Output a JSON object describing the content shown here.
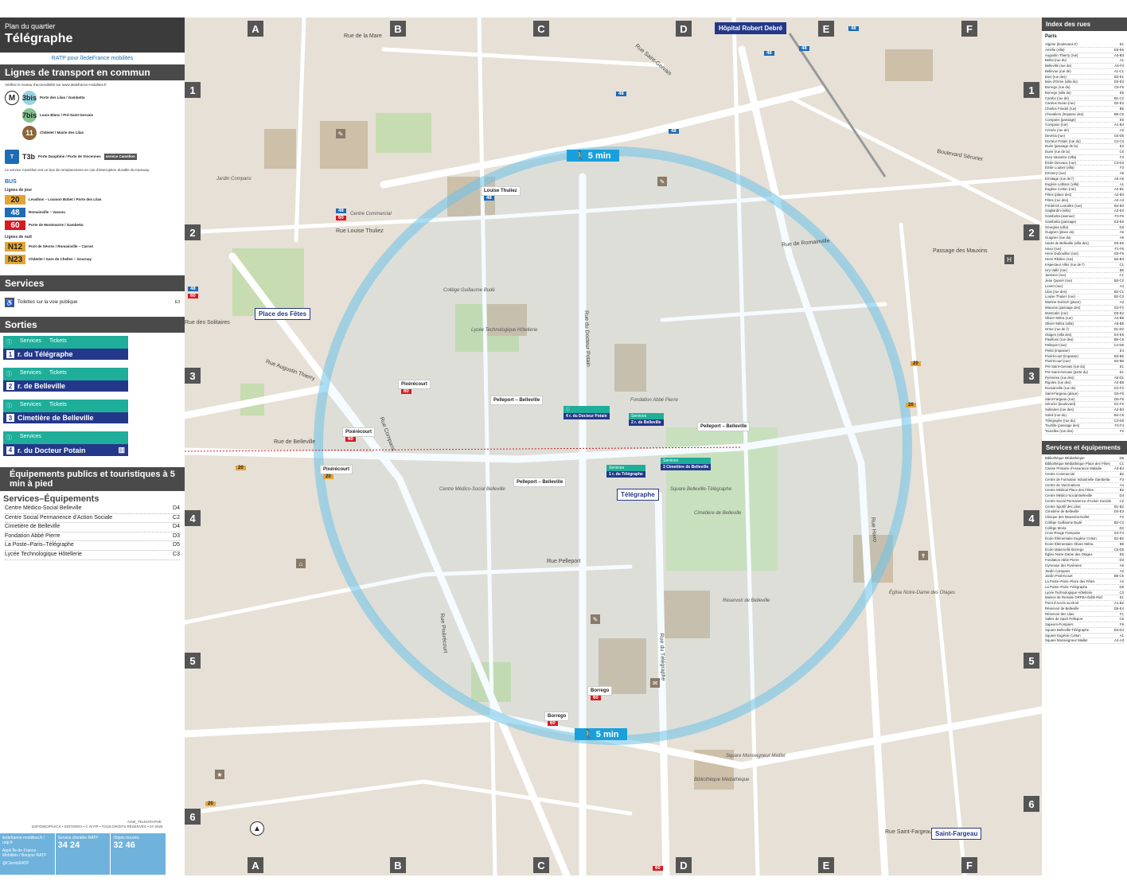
{
  "header": {
    "pre": "Plan du quartier",
    "title": "Télégraphe"
  },
  "logos": {
    "text": "RATP pour îledeFrance mobilités"
  },
  "transport": {
    "title": "Lignes de transport en commun",
    "note": "Vérifiez le niveau d'accessibilité sur www.iledefrance-mobilites.fr",
    "metro": [
      {
        "line": "3bis",
        "dest": "Porte des Lilas / Gambetta",
        "color": "#98d4e2"
      },
      {
        "line": "7bis",
        "dest": "Louis Blanc / Pré-Saint-Gervais",
        "color": "#84c28e"
      },
      {
        "line": "11",
        "dest": "Châtelet / Mairie des Lilas",
        "color": "#8e6538"
      }
    ],
    "tram": {
      "line": "T3b",
      "dest": "Porte Dauphine / Porte de Vincennes",
      "service": "service Camélion"
    },
    "tram_note": "Le service Camélion est un bus de remplacement en cas d'interruption durable du tramway.",
    "bus_label": "BUS",
    "day_label": "Lignes de jour",
    "day": [
      {
        "line": "20",
        "dest": "Levallois – Louison Bobet / Porte des Lilas",
        "color": "#e3a436"
      },
      {
        "line": "48",
        "dest": "Romainville – Vassou",
        "color": "#1f6bb4"
      },
      {
        "line": "60",
        "dest": "Porte de Montmartre / Gambetta",
        "color": "#d71920"
      }
    ],
    "night_label": "Lignes de nuit",
    "night": [
      {
        "line": "N12",
        "dest": "Pont de Sèvres / Romainville – Carnot",
        "color": "#e3a436"
      },
      {
        "line": "N23",
        "dest": "Châtelet / Gare de Chelles – Gournay",
        "color": "#e3a436"
      }
    ]
  },
  "services": {
    "title": "Services",
    "toilets": "Toilettes sur la voie publique",
    "toilets_ref": "E3"
  },
  "sorties": {
    "title": "Sorties",
    "exits": [
      {
        "num": "1",
        "services": "Services",
        "tickets": "Tickets",
        "name": "r. du Télégraphe"
      },
      {
        "num": "2",
        "services": "Services",
        "tickets": "Tickets",
        "name": "r. de Belleville"
      },
      {
        "num": "3",
        "services": "Services",
        "tickets": "Tickets",
        "name": "Cimetière de Belleville"
      },
      {
        "num": "4",
        "services": "Services",
        "tickets": "",
        "name": "r. du Docteur Potain"
      }
    ]
  },
  "equip": {
    "title": "Équipements publics et touristiques à 5 min à pied",
    "sub": "Services–Équipements",
    "items": [
      {
        "name": "Centre Médico-Social Belleville",
        "ref": "D4"
      },
      {
        "name": "Centre Social Permanence d'Action Sociale",
        "ref": "C2"
      },
      {
        "name": "Cimetière de Belleville",
        "ref": "D4"
      },
      {
        "name": "Fondation Abbé Pierre",
        "ref": "D3"
      },
      {
        "name": "La Poste–Paris–Télégraphe",
        "ref": "D5"
      },
      {
        "name": "Lycée Technologique Hôtellerie",
        "ref": "C3"
      }
    ]
  },
  "footer": {
    "web": "iledefrance-mobilites.fr / ratp.fr",
    "app": "Appli Île-de-France Mobilités / Bonjour RATP",
    "social": "@ClientsRATP",
    "svc_title": "Service clientèle RATP",
    "svc_phone": "34 24",
    "lost_title": "Objets trouvés",
    "lost_phone": "32 46",
    "credit": "DSF/DMO/PIVICS • EDITERRA • © RATP • TOUS DROITS RÉSERVÉS • 07-2025",
    "code": "AGM_TELEGRAPHE"
  },
  "map": {
    "cols": [
      "A",
      "B",
      "C",
      "D",
      "E",
      "F"
    ],
    "rows": [
      "1",
      "2",
      "3",
      "4",
      "5",
      "6"
    ],
    "walk_label": "5 min",
    "stations": [
      "Place des Fêtes",
      "Télégraphe",
      "Saint-Fargeau",
      "Hôpital Robert Debré"
    ],
    "stops": [
      "Louise Thuliez",
      "Pixérécourt",
      "Pixérécourt",
      "Pixérécourt",
      "Pelleport – Belleville",
      "Pelleport – Belleville",
      "Pelleport – Belleville",
      "Borrego",
      "Borrego"
    ],
    "streets": [
      "Rue de Belleville",
      "Rue Compans",
      "Rue Pixérécourt",
      "Rue du Télégraphe",
      "Rue Pelleport",
      "Rue Haxo",
      "Boulevard Sérurier",
      "Rue Saint-Fargeau",
      "Rue de la Mare",
      "Rue des Solitaires",
      "Rue du Docteur Potain",
      "Rue Louise Thuliez",
      "Rue de Romainville",
      "Rue Saint-Gervais",
      "Passage des Mauxins",
      "Rue Augustin Thierry"
    ],
    "places": [
      "Square Monseigneur Maillet",
      "Cimetière de Belleville",
      "Lycée Technologique Hôtellerie",
      "Centre Médico-Social Belleville",
      "Fondation Abbé Pierre",
      "Réservoir de Belleville",
      "Square Belleville-Télégraphe",
      "Bibliothèque Médiathèque",
      "Jardin Compans",
      "Centre Commercial",
      "Collège Guillaume Budé",
      "Église Notre-Dame des Otages"
    ]
  },
  "index": {
    "title": "Index des rues",
    "city": "Paris",
    "streets": [
      [
        "Algérie (boulevard d')",
        "E1"
      ],
      [
        "Amélie (villa)",
        "E5-E6"
      ],
      [
        "Augustin Thierry (rue)",
        "A3-B3"
      ],
      [
        "Bellot (rue du)",
        "A1"
      ],
      [
        "Belleville (rue de)",
        "A3-F3"
      ],
      [
        "Bellevue (rue de)",
        "A1-C1"
      ],
      [
        "Bois (rue des)",
        "B2-E1"
      ],
      [
        "Bois d'Orme (villa du)",
        "D3-E3"
      ],
      [
        "Borrego (rue du)",
        "C5-F5"
      ],
      [
        "Borrego (villa du)",
        "E5"
      ],
      [
        "Cambo (rue de)",
        "B1-C2"
      ],
      [
        "Carolus Duran (rue)",
        "D2-E2"
      ],
      [
        "Charles Friedel (rue)",
        "B5"
      ],
      [
        "Chevaliers (impasse des)",
        "B6-C6"
      ],
      [
        "Compans (passage)",
        "E5"
      ],
      [
        "Compans (rue)",
        "A1-B4"
      ],
      [
        "Crimée (rue de)",
        "A2"
      ],
      [
        "Devéria (rue)",
        "C6-D5"
      ],
      [
        "Docteur Potain (rue du)",
        "C2-C3"
      ],
      [
        "Duée (passage de la)",
        "E3"
      ],
      [
        "Duée (rue de la)",
        "C5"
      ],
      [
        "Dury-Vasselon (villa)",
        "F3"
      ],
      [
        "Émile Desvaux (rue)",
        "C3-D3"
      ],
      [
        "Émile Loubet (villa)",
        "F3"
      ],
      [
        "Emmery (rue)",
        "A6"
      ],
      [
        "Ermitage (rue de l')",
        "A5-A6"
      ],
      [
        "Eugène Leblanc (villa)",
        "A1"
      ],
      [
        "Eugène Cotton (rue)",
        "A2-B1"
      ],
      [
        "Fêtes (place des)",
        "A2-B3"
      ],
      [
        "Fêtes (rue des)",
        "A2-A3"
      ],
      [
        "Frédérick Lemaître (rue)",
        "B4-B3"
      ],
      [
        "Gagliardini (villa)",
        "A3-E3"
      ],
      [
        "Gambetta (avenue)",
        "F3-F6"
      ],
      [
        "Gambetta (passage)",
        "E3-E6"
      ],
      [
        "Georgina (villa)",
        "D3"
      ],
      [
        "Guignier (place du)",
        "A6"
      ],
      [
        "Guignier (rue du)",
        "A6"
      ],
      [
        "Hauts de Belleville (villa des)",
        "E5-E6"
      ],
      [
        "Haxo (rue)",
        "F1-F6"
      ],
      [
        "Henri Dubouillon (rue)",
        "E5-F5"
      ],
      [
        "Henri Ribière (rue)",
        "B2-B3"
      ],
      [
        "Inspecteur Allès (rue de l')",
        "C1"
      ],
      [
        "Ivry-Vallé (rue)",
        "B5"
      ],
      [
        "Janssen (rue)",
        "C1"
      ],
      [
        "Jean Quarré (rue)",
        "B3-C2"
      ],
      [
        "Levert (rue)",
        "A4"
      ],
      [
        "Lilas (rue des)",
        "B2-C1"
      ],
      [
        "Louise Thuliez (rue)",
        "B2-C2"
      ],
      [
        "Martine Durlach (place)",
        "A3"
      ],
      [
        "Mauxins (passage des)",
        "E2-F2"
      ],
      [
        "Montcalm (rue)",
        "D3-E2"
      ],
      [
        "Olivier Métra (rue)",
        "A4-B6"
      ],
      [
        "Olivier Métra (villa)",
        "A5-B5"
      ],
      [
        "Orme (rue de l')",
        "D1-D2"
      ],
      [
        "Otages (villa des)",
        "E4-E5"
      ],
      [
        "Pavillons (rue des)",
        "B6-C6"
      ],
      [
        "Pelleport (rue)",
        "C4-D6"
      ],
      [
        "Petits (impasse)",
        "E4"
      ],
      [
        "Pixérécourt (impasse)",
        "B3-B5"
      ],
      [
        "Pixérécourt (rue)",
        "B4-B6"
      ],
      [
        "Pré-Saint-Gervais (rue du)",
        "E1"
      ],
      [
        "Pré-Saint-Gervais (porte du)",
        "E1"
      ],
      [
        "Pyrénées (rue des)",
        "A5-D1"
      ],
      [
        "Rigoles (rue des)",
        "A4-B5"
      ],
      [
        "Romainville (rue de)",
        "D1-F2"
      ],
      [
        "Saint-Fargeau (place)",
        "E6-F6"
      ],
      [
        "Saint-Fargeau (rue)",
        "D6-F5"
      ],
      [
        "Sérurier (boulevard)",
        "D1-F2"
      ],
      [
        "Solitaires (rue des)",
        "A2-B3"
      ],
      [
        "Soleil (rue du)",
        "B4-C5"
      ],
      [
        "Télégraphe (rue du)",
        "C3-D6"
      ],
      [
        "Tourtille (passage des)",
        "F3-F4"
      ],
      [
        "Tourelles (rue des)",
        "F2"
      ]
    ],
    "svc_title": "Services et équipements",
    "svc": [
      [
        "Bibliothèque Médiathèque",
        "D6"
      ],
      [
        "Bibliothèque Médiathèque Place des Fêtes",
        "C1"
      ],
      [
        "Caisse Primaire d'Assurance Maladie",
        "A3-B4"
      ],
      [
        "Centre Commercial",
        "B2"
      ],
      [
        "Centre de Formation Industrielle Gambetta",
        "F3"
      ],
      [
        "Centre de Vaccinations",
        "A4"
      ],
      [
        "Centre Médical Place des Fêtes",
        "B2"
      ],
      [
        "Centre Médico-Social Belleville",
        "D4"
      ],
      [
        "Centre Social Permanence d'Action Sociale",
        "C2"
      ],
      [
        "Centre Sportif des Lilas",
        "B1-B2"
      ],
      [
        "Cimetière de Belleville",
        "D4-E3"
      ],
      [
        "Clinique des Maussins-Nollet",
        "F2"
      ],
      [
        "Collège Guillaume Budé",
        "B2-C2"
      ],
      [
        "Collège Moria",
        "D2"
      ],
      [
        "Croix-Rouge Française",
        "E4-F4"
      ],
      [
        "École Élémentaire Eugène Cotton",
        "B1-B2"
      ],
      [
        "École Élémentaire Olivier Métra",
        "B5"
      ],
      [
        "École Maternelle Borrego",
        "C5-D5"
      ],
      [
        "Église Notre-Dame des Otages",
        "E5"
      ],
      [
        "Fondation Abbé Pierre",
        "D3"
      ],
      [
        "Gymnase des Pyrénées",
        "A6"
      ],
      [
        "Jardin Compans",
        "A2"
      ],
      [
        "Jardin Pixérécourt",
        "B5-C5"
      ],
      [
        "La Poste–Paris–Place des Fêtes",
        "A2"
      ],
      [
        "La Poste–Paris–Télégraphe",
        "D5"
      ],
      [
        "Lycée Technologique Hôtellerie",
        "C3"
      ],
      [
        "Maison de Retraite ORPEA Édith Piaf",
        "E1"
      ],
      [
        "Point d'Accès au Droit",
        "A1-B2"
      ],
      [
        "Réservoir de Belleville",
        "D5-E4"
      ],
      [
        "Réservoir des Lilas",
        "F1"
      ],
      [
        "Salles de Sport Pelleport",
        "C6"
      ],
      [
        "Sapeurs-Pompiers",
        "F6"
      ],
      [
        "Square Belleville-Télégraphe",
        "D3-D4"
      ],
      [
        "Square Eugénie Cotton",
        "A1"
      ],
      [
        "Square Monseigneur Maillet",
        "A2-A3"
      ]
    ]
  }
}
